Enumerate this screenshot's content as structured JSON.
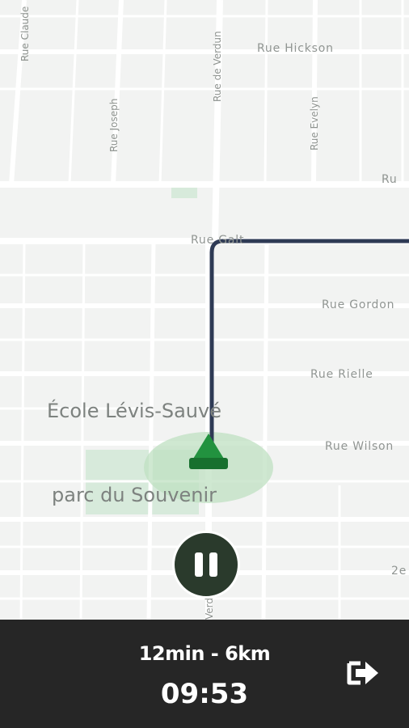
{
  "map": {
    "streets": {
      "rue_claude": "Rue Claude",
      "rue_joseph": "Rue Joseph",
      "rue_de_verdun": "Rue de Verdun",
      "rue_evelyn": "Rue Evelyn",
      "rue_hickson": "Rue Hickson",
      "rue_partial_top": "Ru",
      "rue_partial_route": "Rue Galt",
      "rue_gordon": "Rue Gordon",
      "rue_rielle": "Rue Rielle",
      "rue_wilson": "Rue Wilson",
      "rue_partial_bottom": "2e",
      "verdun_partial": "Verdun"
    },
    "pois": {
      "school": "École Lévis-Sauvé",
      "park": "parc du Souvenir"
    },
    "colors": {
      "route": "#2e3a55",
      "position_marker": "#1f8c3a",
      "accuracy_halo": "#bfe0c2"
    }
  },
  "controls": {
    "pause_icon": "pause-icon",
    "exit_icon": "exit-arrow-icon"
  },
  "trip": {
    "summary": "12min - 6km",
    "eta": "09:53"
  }
}
